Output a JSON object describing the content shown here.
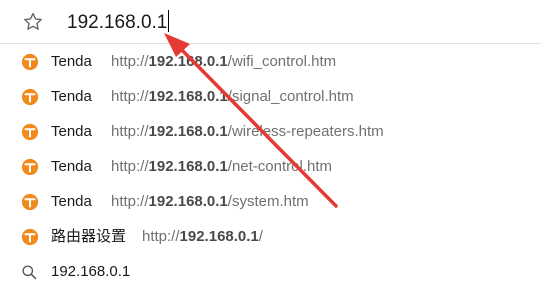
{
  "address_bar": {
    "value": "192.168.0.1"
  },
  "suggestions": [
    {
      "site": "Tenda",
      "url_prefix": "http://",
      "url_host": "192.168.0.1",
      "url_path": "/wifi_control.htm"
    },
    {
      "site": "Tenda",
      "url_prefix": "http://",
      "url_host": "192.168.0.1",
      "url_path": "/signal_control.htm"
    },
    {
      "site": "Tenda",
      "url_prefix": "http://",
      "url_host": "192.168.0.1",
      "url_path": "/wireless-repeaters.htm"
    },
    {
      "site": "Tenda",
      "url_prefix": "http://",
      "url_host": "192.168.0.1",
      "url_path": "/net-control.htm"
    },
    {
      "site": "Tenda",
      "url_prefix": "http://",
      "url_host": "192.168.0.1",
      "url_path": "/system.htm"
    },
    {
      "site": "路由器设置",
      "url_prefix": "http://",
      "url_host": "192.168.0.1",
      "url_path": "/"
    }
  ],
  "search_suggestion": {
    "query": "192.168.0.1",
    "icon": "search-icon"
  },
  "colors": {
    "favicon": "#f08a1c",
    "arrow": "#e53935"
  }
}
